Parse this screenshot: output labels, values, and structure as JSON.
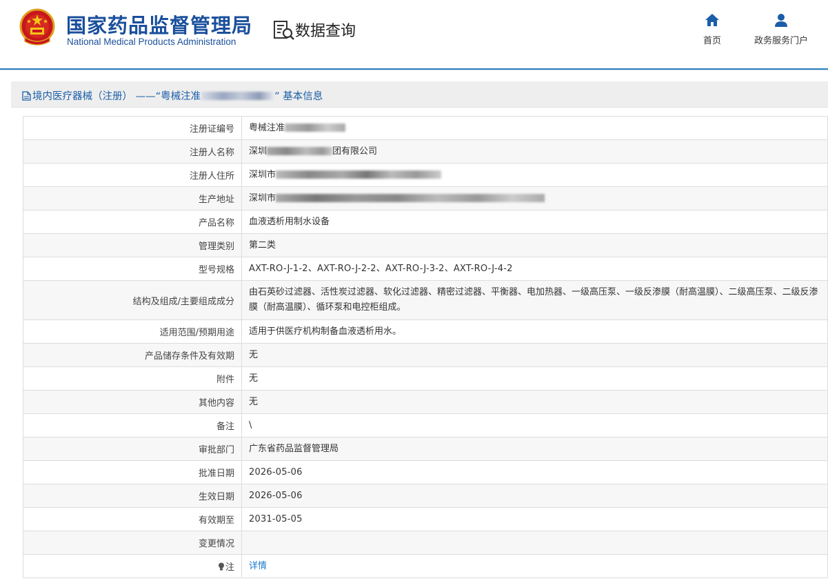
{
  "header": {
    "brand_cn": "国家药品监督管理局",
    "brand_en": "National Medical Products Administration",
    "section_title": "数据查询",
    "nav": [
      {
        "label": "首页",
        "icon": "home-icon"
      },
      {
        "label": "政务服务门户",
        "icon": "user-icon"
      }
    ],
    "accent_color": "#1a4f9c"
  },
  "title_bar": {
    "prefix": "境内医疗器械（注册） ——“粤械注准",
    "suffix": "” 基本信息"
  },
  "rows": [
    {
      "label": "注册证编号",
      "value": "粤械注准"
    },
    {
      "label": "注册人名称",
      "value": "深圳",
      "value_after": "团有限公司"
    },
    {
      "label": "注册人住所",
      "value": "深圳市"
    },
    {
      "label": "生产地址",
      "value": "深圳市"
    },
    {
      "label": "产品名称",
      "value": "血液透析用制水设备"
    },
    {
      "label": "管理类别",
      "value": "第二类"
    },
    {
      "label": "型号规格",
      "value": "AXT-RO-J-1-2、AXT-RO-J-2-2、AXT-RO-J-3-2、AXT-RO-J-4-2"
    },
    {
      "label": "结构及组成/主要组成成分",
      "value": "由石英砂过滤器、活性炭过滤器、软化过滤器、精密过滤器、平衡器、电加热器、一级高压泵、一级反渗膜（耐高温膜）、二级高压泵、二级反渗膜（耐高温膜）、循环泵和电控柜组成。"
    },
    {
      "label": "适用范围/预期用途",
      "value": "适用于供医疗机构制备血液透析用水。"
    },
    {
      "label": "产品储存条件及有效期",
      "value": "无"
    },
    {
      "label": "附件",
      "value": "无"
    },
    {
      "label": "其他内容",
      "value": "无"
    },
    {
      "label": "备注",
      "value": "\\"
    },
    {
      "label": "审批部门",
      "value": "广东省药品监督管理局"
    },
    {
      "label": "批准日期",
      "value": "2026-05-06"
    },
    {
      "label": "生效日期",
      "value": "2026-05-06"
    },
    {
      "label": "有效期至",
      "value": "2031-05-05"
    },
    {
      "label": "变更情况",
      "value": ""
    },
    {
      "label": "注",
      "value": "详情"
    }
  ]
}
